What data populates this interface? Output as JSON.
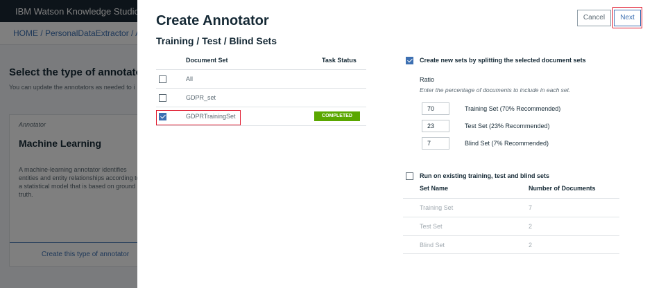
{
  "background": {
    "brand": "IBM Watson Knowledge Studio",
    "breadcrumb": "HOME / PersonalDataExtractor / Anno",
    "heading": "Select the type of annotator t",
    "subheading": "You can update the annotators as needed to i",
    "card": {
      "tag": "Annotator",
      "title": "Machine Learning",
      "description": "A machine-learning annotator identifies entities and entity relationships according to a statistical model that is based on ground truth.",
      "button_label": "Create this type of annotator"
    }
  },
  "modal": {
    "title": "Create Annotator",
    "subtitle": "Training / Test / Blind Sets",
    "cancel_label": "Cancel",
    "next_label": "Next"
  },
  "document_table": {
    "headers": {
      "document_set": "Document Set",
      "task_status": "Task Status"
    },
    "rows": [
      {
        "name": "All",
        "checked": false,
        "status": ""
      },
      {
        "name": "GDPR_set",
        "checked": false,
        "status": ""
      },
      {
        "name": "GDPRTrainingSet",
        "checked": true,
        "status": "COMPLETED"
      }
    ]
  },
  "split_option": {
    "label": "Create new sets by splitting the selected document sets",
    "checked": true,
    "ratio_label": "Ratio",
    "ratio_help": "Enter the percentage of documents to include in each set.",
    "inputs": [
      {
        "value": "70",
        "label": "Training Set  (70% Recommended)"
      },
      {
        "value": "23",
        "label": "Test Set  (23% Recommended)"
      },
      {
        "value": "7",
        "label": "Blind Set  (7% Recommended)"
      }
    ]
  },
  "existing_option": {
    "label": "Run on existing training, test and blind sets",
    "checked": false,
    "headers": {
      "set_name": "Set Name",
      "num_docs": "Number of Documents"
    },
    "rows": [
      {
        "name": "Training Set",
        "count": "7"
      },
      {
        "name": "Test Set",
        "count": "2"
      },
      {
        "name": "Blind Set",
        "count": "2"
      }
    ]
  },
  "colors": {
    "accent": "#3d70b2",
    "status_completed": "#5aa700",
    "highlight_box": "#e0182d",
    "overlay": "rgba(0,0,0,0.5)"
  }
}
